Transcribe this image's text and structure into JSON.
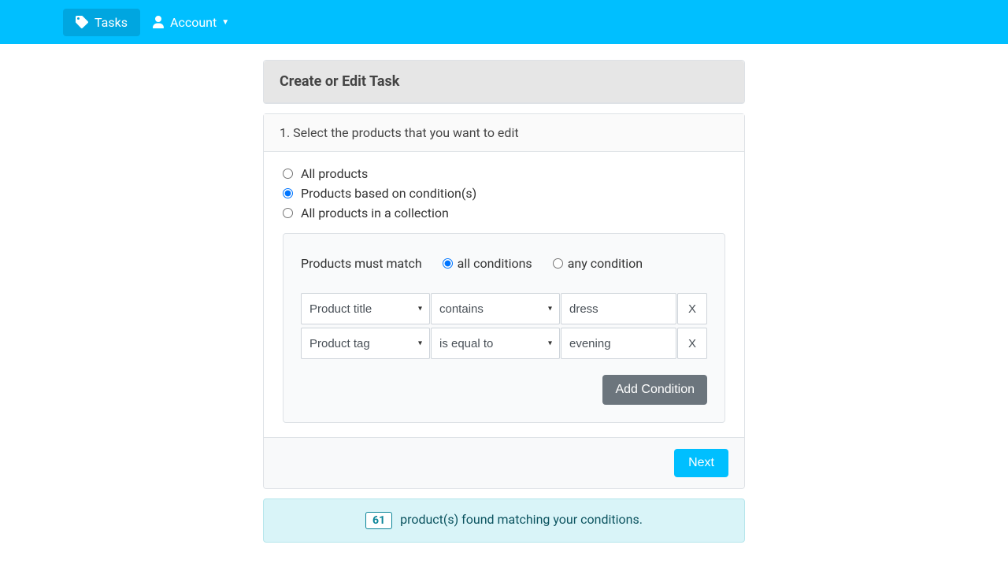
{
  "nav": {
    "tasks": "Tasks",
    "account": "Account"
  },
  "header": {
    "title": "Create or Edit Task"
  },
  "step": {
    "title": "1. Select the products that you want to edit"
  },
  "radios": {
    "all": "All products",
    "conditions": "Products based on condition(s)",
    "collection": "All products in a collection"
  },
  "match": {
    "label": "Products must match",
    "all": "all conditions",
    "any": "any condition"
  },
  "rows": {
    "r0": {
      "field": "Product title",
      "op": "contains",
      "value": "dress",
      "remove": "X"
    },
    "r1": {
      "field": "Product tag",
      "op": "is equal to",
      "value": "evening",
      "remove": "X"
    }
  },
  "buttons": {
    "add": "Add Condition",
    "next": "Next"
  },
  "result": {
    "count": "61",
    "text": "product(s) found matching your conditions."
  }
}
